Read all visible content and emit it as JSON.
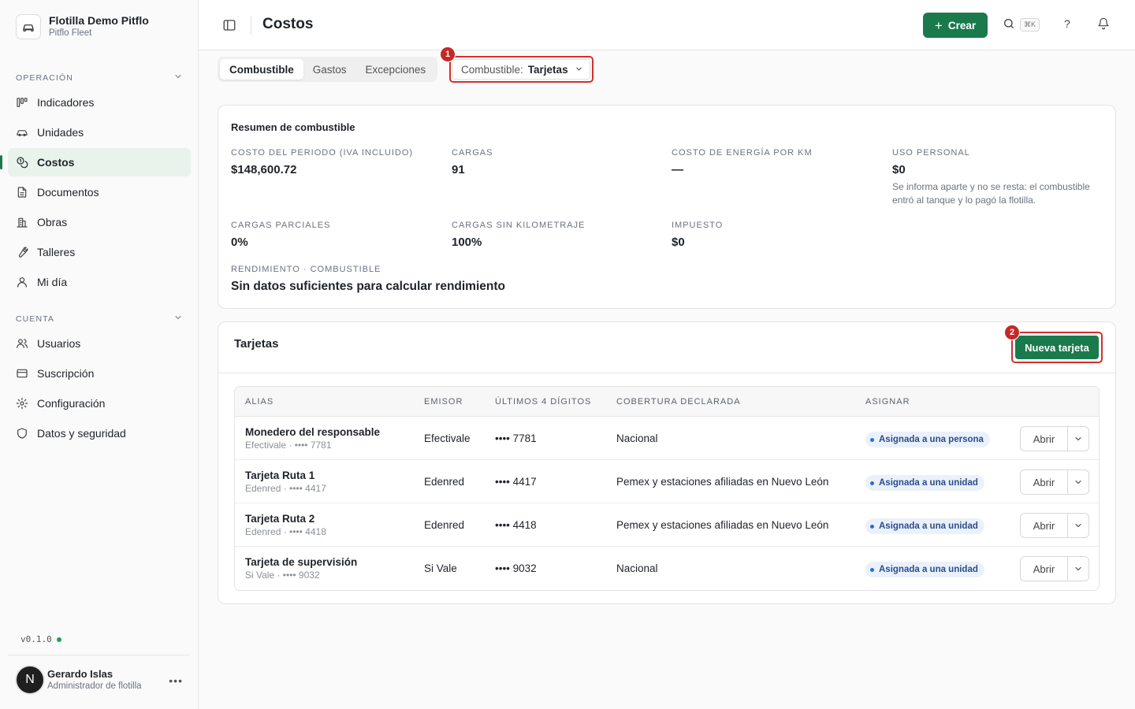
{
  "org": {
    "name": "Flotilla Demo Pitflo",
    "sub": "Pitflo Fleet"
  },
  "sidebar": {
    "sections": [
      {
        "label": "OPERACIÓN",
        "items": [
          {
            "label": "Indicadores",
            "icon": "kanban-icon",
            "active": false
          },
          {
            "label": "Unidades",
            "icon": "car-icon",
            "active": false
          },
          {
            "label": "Costos",
            "icon": "coins-icon",
            "active": true
          },
          {
            "label": "Documentos",
            "icon": "document-icon",
            "active": false
          },
          {
            "label": "Obras",
            "icon": "building-icon",
            "active": false
          },
          {
            "label": "Talleres",
            "icon": "wrench-icon",
            "active": false
          },
          {
            "label": "Mi día",
            "icon": "person-icon",
            "active": false
          }
        ]
      },
      {
        "label": "CUENTA",
        "items": [
          {
            "label": "Usuarios",
            "icon": "users-icon",
            "active": false
          },
          {
            "label": "Suscripción",
            "icon": "credit-card-icon",
            "active": false
          },
          {
            "label": "Configuración",
            "icon": "gear-icon",
            "active": false
          },
          {
            "label": "Datos y seguridad",
            "icon": "shield-icon",
            "active": false
          }
        ]
      }
    ],
    "version": "v0.1.0",
    "user": {
      "initial": "N",
      "name": "Gerardo Islas",
      "role": "Administrador de flotilla"
    }
  },
  "header": {
    "title": "Costos",
    "create_label": "Crear",
    "search_shortcut": "⌘K",
    "help": "?"
  },
  "tabs": [
    {
      "label": "Combustible",
      "active": true
    },
    {
      "label": "Gastos",
      "active": false
    },
    {
      "label": "Excepciones",
      "active": false
    }
  ],
  "filter": {
    "prefix": "Combustible:",
    "value": "Tarjetas",
    "badge": "1"
  },
  "summary": {
    "title": "Resumen de combustible",
    "metrics": [
      {
        "label": "COSTO DEL PERIODO (IVA INCLUIDO)",
        "value": "$148,600.72"
      },
      {
        "label": "CARGAS",
        "value": "91"
      },
      {
        "label": "COSTO DE ENERGÍA POR KM",
        "value": "—"
      },
      {
        "label": "USO PERSONAL",
        "value": "$0",
        "note": "Se informa aparte y no se resta: el combustible entró al tanque y lo pagó la flotilla."
      },
      {
        "label": "CARGAS PARCIALES",
        "value": "0%"
      },
      {
        "label": "CARGAS SIN KILOMETRAJE",
        "value": "100%"
      },
      {
        "label": "IMPUESTO",
        "value": "$0"
      },
      {
        "label": "RENDIMIENTO · COMBUSTIBLE",
        "value": "Sin datos suficientes para calcular rendimiento"
      }
    ]
  },
  "tarjetas": {
    "title": "Tarjetas",
    "new_label": "Nueva tarjeta",
    "badge": "2",
    "columns": [
      "ALIAS",
      "EMISOR",
      "ÚLTIMOS 4 DÍGITOS",
      "COBERTURA DECLARADA",
      "ASIGNAR"
    ],
    "rows": [
      {
        "alias": "Monedero del responsable",
        "sub": "Efectivale · •••• 7781",
        "emisor": "Efectivale",
        "digits": "•••• 7781",
        "cobertura": "Nacional",
        "asignar": "Asignada a una persona",
        "open": "Abrir"
      },
      {
        "alias": "Tarjeta Ruta 1",
        "sub": "Edenred · •••• 4417",
        "emisor": "Edenred",
        "digits": "•••• 4417",
        "cobertura": "Pemex y estaciones afiliadas en Nuevo León",
        "asignar": "Asignada a una unidad",
        "open": "Abrir"
      },
      {
        "alias": "Tarjeta Ruta 2",
        "sub": "Edenred · •••• 4418",
        "emisor": "Edenred",
        "digits": "•••• 4418",
        "cobertura": "Pemex y estaciones afiliadas en Nuevo León",
        "asignar": "Asignada a una unidad",
        "open": "Abrir"
      },
      {
        "alias": "Tarjeta de supervisión",
        "sub": "Si Vale · •••• 9032",
        "emisor": "Si Vale",
        "digits": "•••• 9032",
        "cobertura": "Nacional",
        "asignar": "Asignada a una unidad",
        "open": "Abrir"
      }
    ]
  },
  "colors": {
    "brand_green": "#1a7a4c",
    "annotation_red": "#d32f2f",
    "pill_bg": "#eaf1fb",
    "pill_text": "#2a4d8f"
  }
}
